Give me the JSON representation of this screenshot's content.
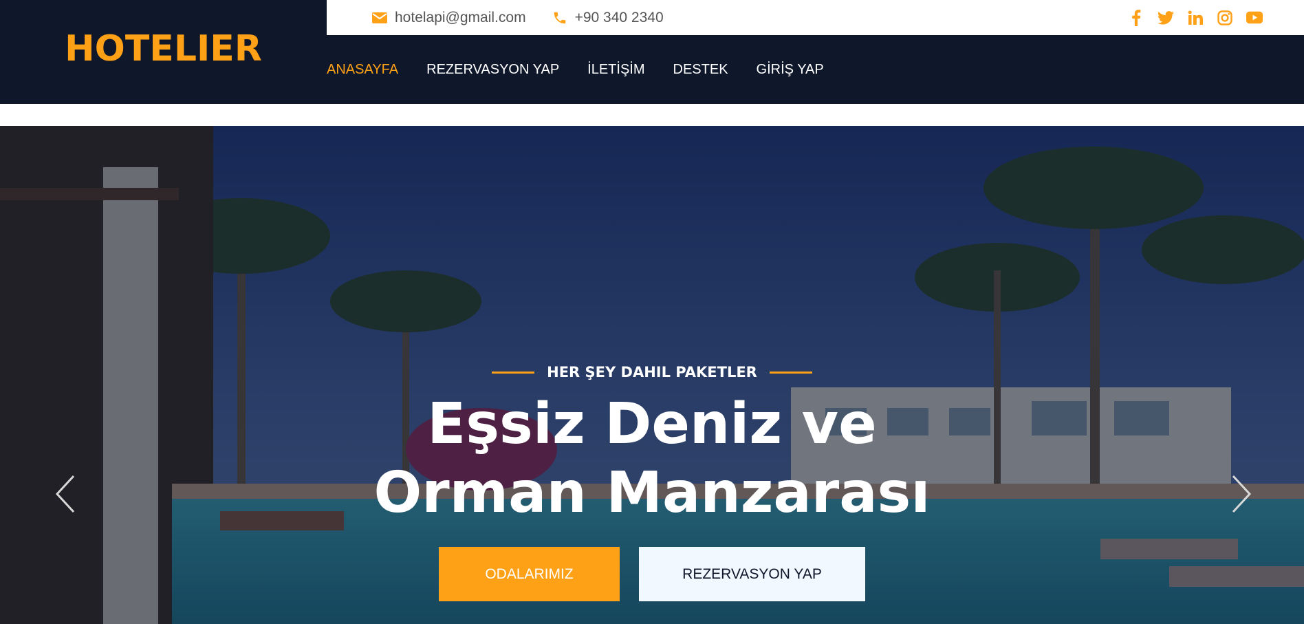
{
  "brand": {
    "name": "HOTELIER"
  },
  "topbar": {
    "email": "hotelapi@gmail.com",
    "phone": "+90 340 2340",
    "socials": [
      "facebook-icon",
      "twitter-icon",
      "linkedin-icon",
      "instagram-icon",
      "youtube-icon"
    ]
  },
  "nav": {
    "items": [
      {
        "label": "ANASAYFA",
        "active": true
      },
      {
        "label": "REZERVASYON YAP",
        "active": false
      },
      {
        "label": "İLETİŞİM",
        "active": false
      },
      {
        "label": "DESTEK",
        "active": false
      },
      {
        "label": "GİRİŞ YAP",
        "active": false
      }
    ]
  },
  "hero": {
    "subtitle": "HER ŞEY DAHIL PAKETLER",
    "title_line1": "Eşsiz Deniz ve",
    "title_line2": "Orman Manzarası",
    "primary_button": "ODALARIMIZ",
    "secondary_button": "REZERVASYON YAP"
  },
  "colors": {
    "accent": "#fea116",
    "dark": "#0f172b",
    "light_button": "#f1f8ff"
  }
}
